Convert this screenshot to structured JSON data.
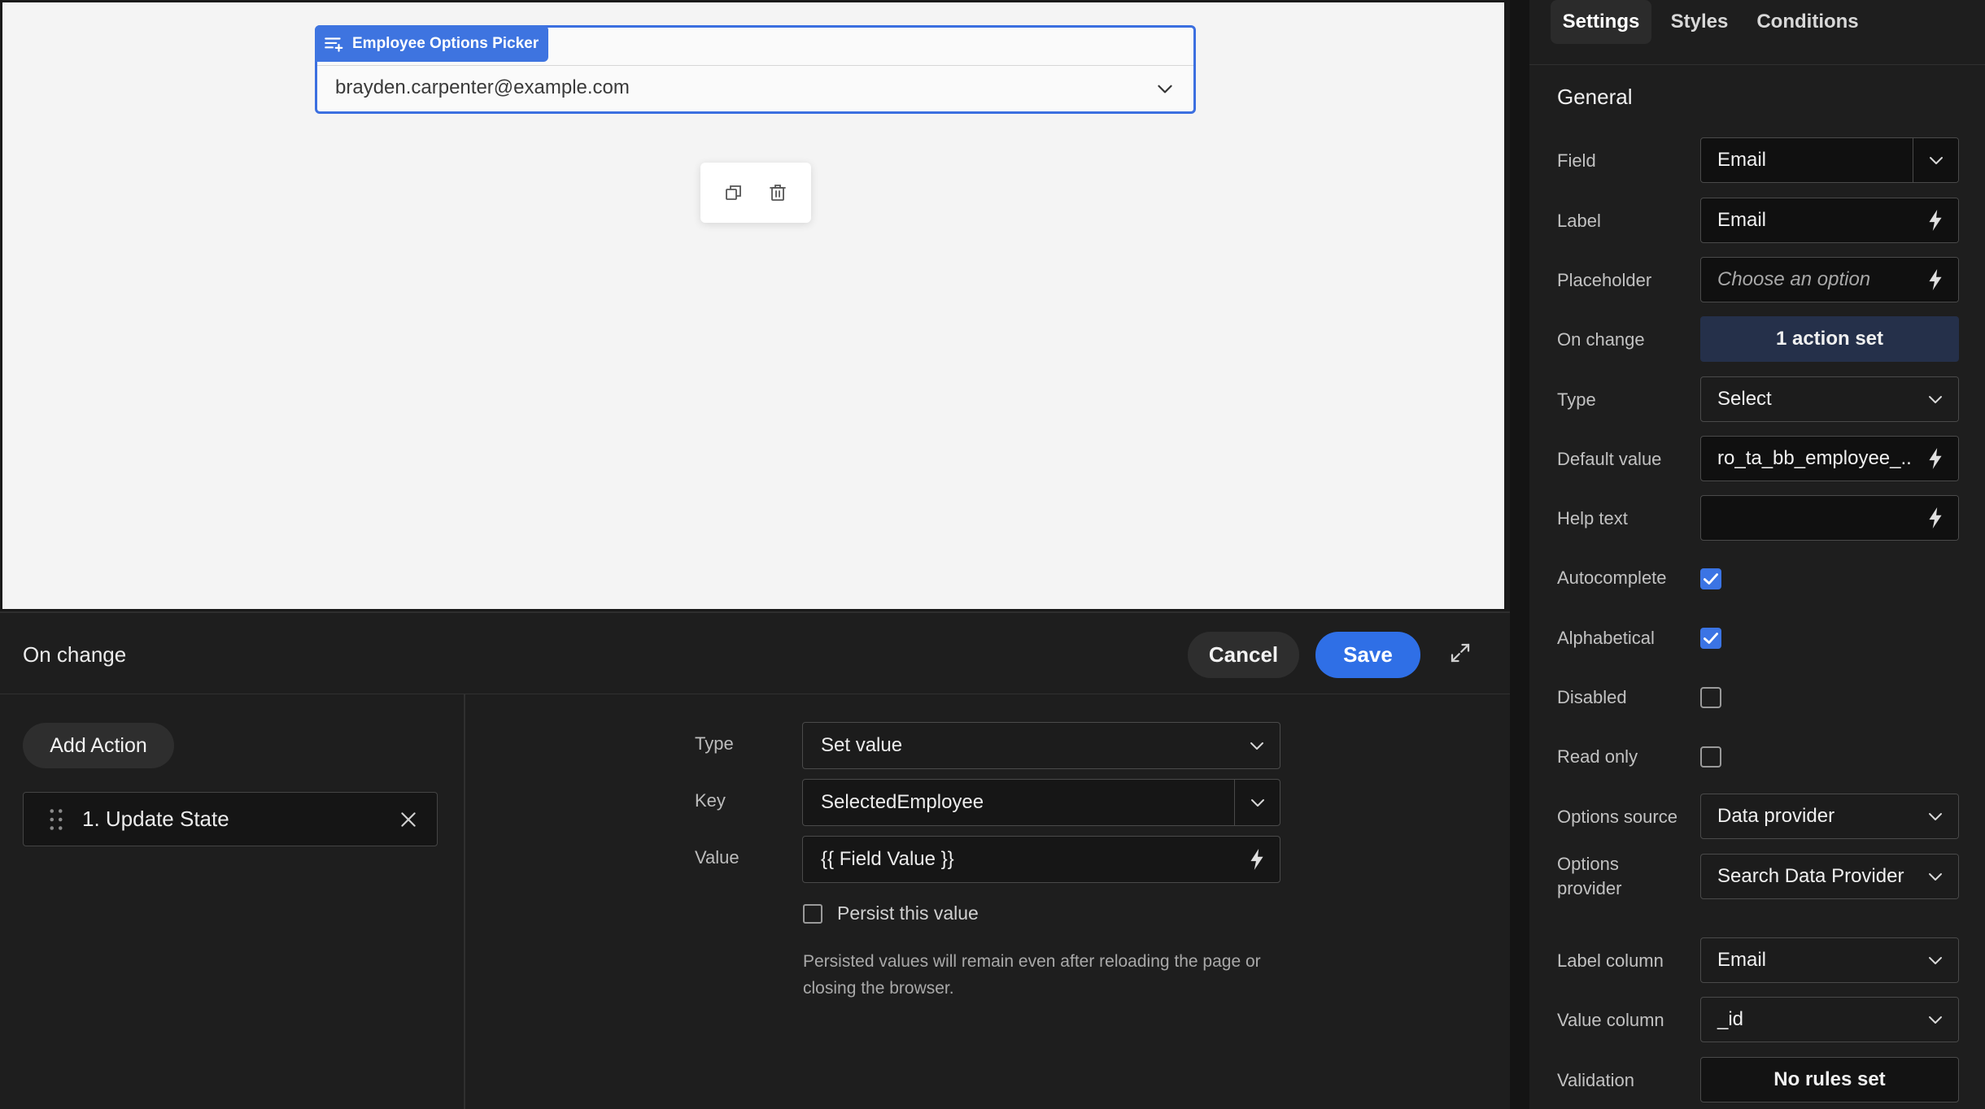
{
  "canvas": {
    "picker": {
      "tag_label": "Employee Options Picker",
      "value": "brayden.carpenter@example.com"
    },
    "tools": [
      "duplicate-icon",
      "trash-icon"
    ]
  },
  "on_change_panel": {
    "title": "On change",
    "cancel_label": "Cancel",
    "save_label": "Save",
    "add_action_label": "Add Action",
    "actions": [
      {
        "label": "1. Update State"
      }
    ],
    "form": {
      "type_label": "Type",
      "type_value": "Set value",
      "key_label": "Key",
      "key_value": "SelectedEmployee",
      "value_label": "Value",
      "value_value": "{{ Field Value }}",
      "persist_label": "Persist this value",
      "persist_checked": false,
      "persist_note": "Persisted values will remain even after reloading the page or closing the browser."
    }
  },
  "settings": {
    "tabs": [
      {
        "label": "Settings",
        "active": true
      },
      {
        "label": "Styles",
        "active": false
      },
      {
        "label": "Conditions",
        "active": false
      }
    ],
    "section_title": "General",
    "rows": {
      "field": {
        "label": "Field",
        "value": "Email"
      },
      "label": {
        "label": "Label",
        "value": "Email"
      },
      "placeholder": {
        "label": "Placeholder",
        "value": "Choose an option"
      },
      "on_change": {
        "label": "On change",
        "value": "1 action set"
      },
      "type": {
        "label": "Type",
        "value": "Select"
      },
      "default_value": {
        "label": "Default value",
        "value": "ro_ta_bb_employee_..."
      },
      "help_text": {
        "label": "Help text",
        "value": ""
      },
      "autocomplete": {
        "label": "Autocomplete",
        "checked": true
      },
      "alphabetical": {
        "label": "Alphabetical",
        "checked": true
      },
      "disabled": {
        "label": "Disabled",
        "checked": false
      },
      "read_only": {
        "label": "Read only",
        "checked": false
      },
      "options_source": {
        "label": "Options source",
        "value": "Data provider"
      },
      "options_provider": {
        "label_line1": "Options",
        "label_line2": "provider",
        "value": "Search Data Provider"
      },
      "label_column": {
        "label": "Label column",
        "value": "Email"
      },
      "value_column": {
        "label": "Value column",
        "value": "_id"
      },
      "validation": {
        "label": "Validation",
        "value": "No rules set"
      }
    }
  },
  "colors": {
    "accent": "#2f6fe6",
    "canvas_bg": "#f4f4f4",
    "panel_bg": "#1e1e1e"
  }
}
